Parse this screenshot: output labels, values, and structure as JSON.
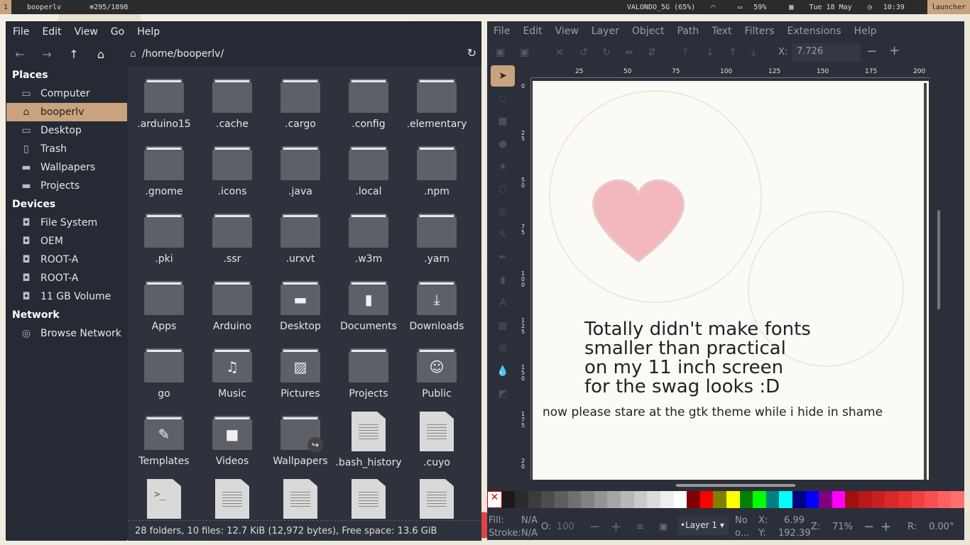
{
  "topbar": {
    "workspace": "1",
    "title": "booperlv",
    "count": "⊕295/1898",
    "wifi": "VALONDO_5G (65%)",
    "battery": "59%",
    "date": "Tue 18 May",
    "time": "10:39",
    "launcher": "launcher"
  },
  "fm": {
    "menu": [
      "File",
      "Edit",
      "View",
      "Go",
      "Help"
    ],
    "path": "/home/booperlv/",
    "sections": {
      "places": "Places",
      "devices": "Devices",
      "network": "Network"
    },
    "places": [
      "Computer",
      "booperlv",
      "Desktop",
      "Trash",
      "Wallpapers",
      "Projects"
    ],
    "devices": [
      "File System",
      "OEM",
      "ROOT-A",
      "ROOT-A",
      "11 GB Volume"
    ],
    "network": [
      "Browse Network"
    ],
    "files": [
      ".arduino15",
      ".cache",
      ".cargo",
      ".config",
      ".elementary",
      ".gnome",
      ".icons",
      ".java",
      ".local",
      ".npm",
      ".pki",
      ".ssr",
      ".urxvt",
      ".w3m",
      ".yarn",
      "Apps",
      "Arduino",
      "Desktop",
      "Documents",
      "Downloads",
      "go",
      "Music",
      "Pictures",
      "Projects",
      "Public",
      "Templates",
      "Videos",
      "Wallpapers",
      ".bash_history",
      ".cuyo",
      "",
      "",
      "",
      "",
      ""
    ],
    "status": "28 folders, 10 files: 12.7 KiB (12,972 bytes), Free space: 13.6 GiB"
  },
  "ink": {
    "menu": [
      "File",
      "Edit",
      "View",
      "Layer",
      "Object",
      "Path",
      "Text",
      "Filters",
      "Extensions",
      "Help"
    ],
    "x_label": "X:",
    "x_value": "7.726",
    "ruler_top": [
      "25",
      "50",
      "75",
      "100",
      "125",
      "150",
      "175",
      "200"
    ],
    "ruler_left": [
      "0",
      "2 5",
      "5 0",
      "7 5",
      "1 0 0",
      "1 2 5",
      "1 5 0",
      "1 7 5",
      "2 0"
    ],
    "canvas_title": [
      "Totally didn't make fonts",
      "smaller than practical",
      "on my 11 inch screen",
      "for the swag looks :D"
    ],
    "canvas_sub": "now please stare at the gtk theme while i hide in shame",
    "fill_label": "Fill:",
    "fill_value": "N/A",
    "stroke_label": "Stroke:",
    "stroke_value": "N/A",
    "opacity_label": "O:",
    "opacity_value": "100",
    "layer": "•Layer 1",
    "no_obj": [
      "No",
      "o..."
    ],
    "x_coord_label": "X:",
    "x_coord": "6.99",
    "y_coord_label": "Y:",
    "y_coord": "192.39",
    "zoom_label": "Z:",
    "zoom": "71%",
    "rot_label": "R:",
    "rot": "0.00°",
    "palette": [
      "#1a1a1a",
      "#2b2b2b",
      "#3c3c3c",
      "#4d4d4d",
      "#5e5e5e",
      "#707070",
      "#828282",
      "#949494",
      "#a6a6a6",
      "#b8b8b8",
      "#cacaca",
      "#dcdcdc",
      "#eeeeee",
      "#ffffff",
      "#800000",
      "#ff0000",
      "#808000",
      "#ffff00",
      "#008000",
      "#00ff00",
      "#008080",
      "#00ffff",
      "#000080",
      "#0000ff",
      "#800080",
      "#ff00ff",
      "#a01010",
      "#b81818",
      "#c82020",
      "#d82828",
      "#e83030",
      "#f04040",
      "#f85050",
      "#ff6060",
      "#ff7070"
    ]
  }
}
